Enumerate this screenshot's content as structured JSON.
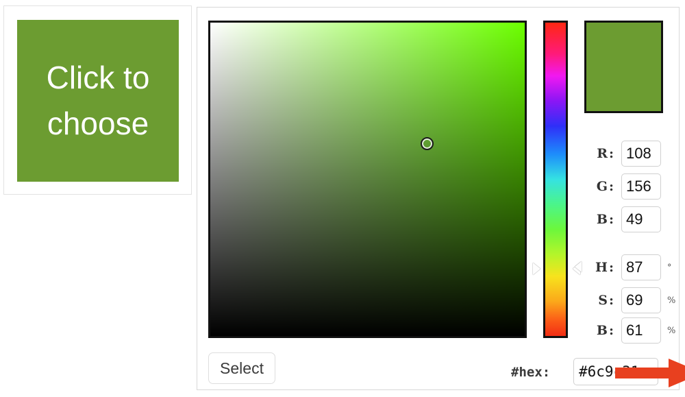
{
  "trigger": {
    "label_line1": "Click to",
    "label_line2": "choose",
    "color": "#6c9c31"
  },
  "picker": {
    "selected_color": "#6c9c31",
    "hue_color": "#6cff00",
    "sv_cursor": {
      "x_pct": 68,
      "y_pct": 38
    },
    "hue_marker_pct": 81,
    "fields": [
      {
        "key": "r",
        "label": "R:",
        "value": "108",
        "unit": ""
      },
      {
        "key": "g",
        "label": "G:",
        "value": "156",
        "unit": ""
      },
      {
        "key": "b",
        "label": "B:",
        "value": "49",
        "unit": ""
      },
      {
        "key": "h",
        "label": "H:",
        "value": "87",
        "unit": "°"
      },
      {
        "key": "s",
        "label": "S:",
        "value": "69",
        "unit": "%"
      },
      {
        "key": "b2",
        "label": "B:",
        "value": "61",
        "unit": "%"
      }
    ],
    "select_label": "Select",
    "hex_label": "#hex:",
    "hex_value": "#6c9c31"
  },
  "annotation": {
    "arrow_color": "#e8401f",
    "arrow_direction": "right"
  }
}
